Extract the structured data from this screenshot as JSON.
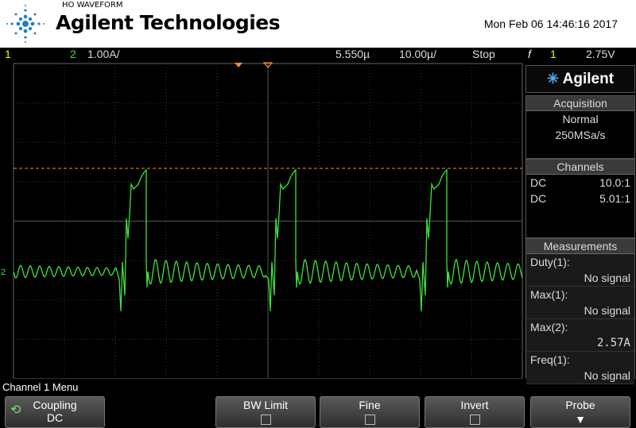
{
  "header": {
    "subtitle": "HO WAVEFORM",
    "brand": "Agilent Technologies",
    "timestamp": "Mon Feb 06 14:46:16 2017"
  },
  "status": {
    "ch1_label": "1",
    "ch2_label": "2",
    "ch2_scale": "1.00A/",
    "time_offset": "5.550µ",
    "time_scale": "10.00µ/",
    "run_state": "Stop",
    "trigger_source": "1",
    "trigger_level": "2.75V"
  },
  "screen": {
    "ch2_marker": "2"
  },
  "panel": {
    "logo_text": "Agilent",
    "acquisition": {
      "title": "Acquisition",
      "mode": "Normal",
      "rate": "250MSa/s"
    },
    "channels": {
      "title": "Channels",
      "rows": [
        {
          "coupling": "DC",
          "probe": "10.0:1"
        },
        {
          "coupling": "DC",
          "probe": "5.01:1"
        }
      ]
    },
    "measurements": {
      "title": "Measurements",
      "items": [
        {
          "name": "Duty(1):",
          "value": "No signal"
        },
        {
          "name": "Max(1):",
          "value": "No signal"
        },
        {
          "name": "Max(2):",
          "value": "2.57A"
        },
        {
          "name": "Freq(1):",
          "value": "No signal"
        }
      ]
    }
  },
  "menu": {
    "title": "Channel 1 Menu",
    "keys": [
      {
        "label": "Coupling",
        "value": "DC"
      },
      {
        "label": "BW Limit"
      },
      {
        "label": "Fine"
      },
      {
        "label": "Invert"
      },
      {
        "label": "Probe"
      }
    ]
  },
  "colors": {
    "ch1": "#f4f40e",
    "ch2": "#40e040",
    "trigger_line": "#ff8c2a"
  }
}
